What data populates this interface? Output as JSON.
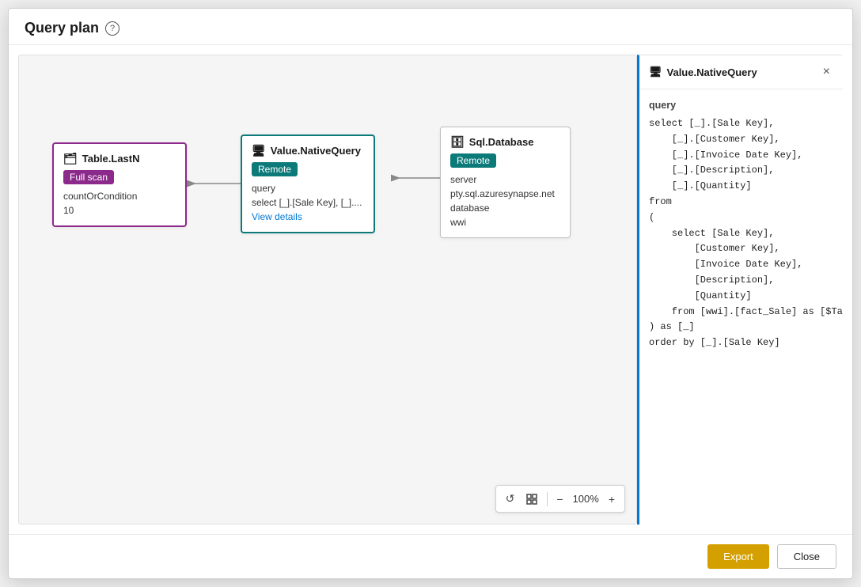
{
  "modal": {
    "title": "Query plan",
    "help_icon": "?",
    "footer": {
      "export_label": "Export",
      "close_label": "Close"
    }
  },
  "nodes": {
    "table_last_n": {
      "title": "Table.LastN",
      "badge": "Full scan",
      "prop1_key": "countOrCondition",
      "prop1_val": "10"
    },
    "value_native_query": {
      "title": "Value.NativeQuery",
      "badge": "Remote",
      "prop1_key": "query",
      "prop1_val": "select [_].[Sale Key], [_]....",
      "link_label": "View details"
    },
    "sql_database": {
      "title": "Sql.Database",
      "badge": "Remote",
      "server_key": "server",
      "server_val": "pty.sql.azuresynapse.net",
      "database_key": "database",
      "database_val": "wwi"
    }
  },
  "side_panel": {
    "title": "Value.NativeQuery",
    "close_icon": "×",
    "label": "query",
    "sql": "select [_].[Sale Key],\n    [_].[Customer Key],\n    [_].[Invoice Date Key],\n    [_].[Description],\n    [_].[Quantity]\nfrom\n(\n    select [Sale Key],\n        [Customer Key],\n        [Invoice Date Key],\n        [Description],\n        [Quantity]\n    from [wwi].[fact_Sale] as [$Table]\n) as [_]\norder by [_].[Sale Key]"
  },
  "toolbar": {
    "zoom_level": "100%",
    "reset_icon": "↺",
    "fit_icon": "⊕",
    "zoom_out_icon": "−",
    "zoom_in_icon": "+"
  }
}
